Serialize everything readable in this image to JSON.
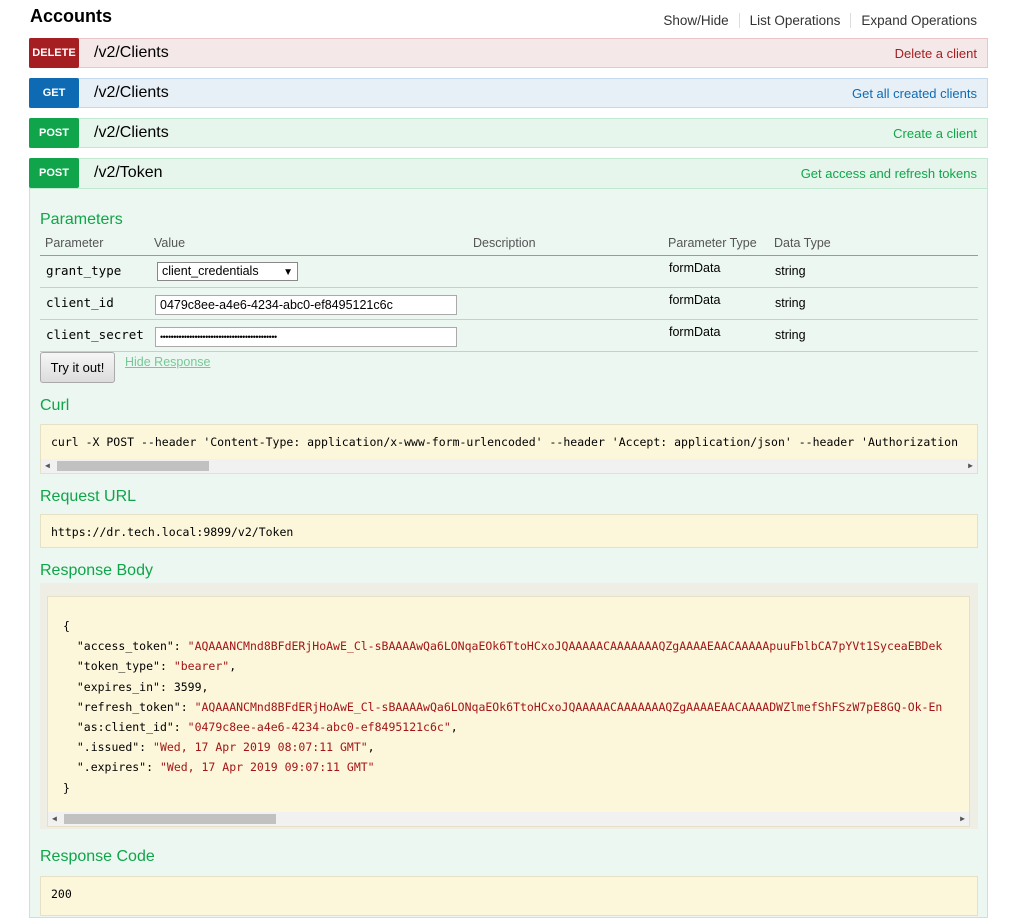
{
  "header": {
    "title": "Accounts",
    "links": [
      "Show/Hide",
      "List Operations",
      "Expand Operations"
    ]
  },
  "operations": [
    {
      "method": "DELETE",
      "path": "/v2/Clients",
      "summary": "Delete a client"
    },
    {
      "method": "GET",
      "path": "/v2/Clients",
      "summary": "Get all created clients"
    },
    {
      "method": "POST",
      "path": "/v2/Clients",
      "summary": "Create a client"
    },
    {
      "method": "POST",
      "path": "/v2/Token",
      "summary": "Get access and refresh tokens"
    }
  ],
  "parameters": {
    "title": "Parameters",
    "columns": [
      "Parameter",
      "Value",
      "Description",
      "Parameter Type",
      "Data Type"
    ],
    "rows": [
      {
        "name": "grant_type",
        "value": "client_credentials",
        "type": "formData",
        "data_type": "string"
      },
      {
        "name": "client_id",
        "value": "0479c8ee-a4e6-4234-abc0-ef8495121c6c",
        "type": "formData",
        "data_type": "string"
      },
      {
        "name": "client_secret",
        "value": "••••••••••••••••••••••••••••••••••••••••••••",
        "type": "formData",
        "data_type": "string"
      }
    ]
  },
  "actions": {
    "try_label": "Try it out!",
    "hide_label": "Hide Response"
  },
  "curl": {
    "title": "Curl",
    "command": "curl -X POST --header 'Content-Type: application/x-www-form-urlencoded' --header 'Accept: application/json' --header 'Authorization"
  },
  "request_url": {
    "title": "Request URL",
    "value": "https://dr.tech.local:9899/v2/Token"
  },
  "response_body": {
    "title": "Response Body",
    "open": "{",
    "close": "}",
    "lines": [
      {
        "key": "\"access_token\"",
        "value": "\"AQAAANCMnd8BFdERjHoAwE_Cl-sBAAAAwQa6LONqaEOk6TtoHCxoJQAAAAACAAAAAAAQZgAAAAEAACAAAAApuuFblbCA7pYVt1SyceaEBDek",
        "suffix": ""
      },
      {
        "key": "\"token_type\"",
        "value": "\"bearer\"",
        "suffix": ","
      },
      {
        "key": "\"expires_in\"",
        "value": "3599",
        "suffix": ","
      },
      {
        "key": "\"refresh_token\"",
        "value": "\"AQAAANCMnd8BFdERjHoAwE_Cl-sBAAAAwQa6LONqaEOk6TtoHCxoJQAAAAACAAAAAAAQZgAAAAEAACAAAADWZlmefShFSzW7pE8GQ-Ok-En",
        "suffix": ""
      },
      {
        "key": "\"as:client_id\"",
        "value": "\"0479c8ee-a4e6-4234-abc0-ef8495121c6c\"",
        "suffix": ","
      },
      {
        "key": "\".issued\"",
        "value": "\"Wed, 17 Apr 2019 08:07:11 GMT\"",
        "suffix": ","
      },
      {
        "key": "\".expires\"",
        "value": "\"Wed, 17 Apr 2019 09:07:11 GMT\"",
        "suffix": ""
      }
    ]
  },
  "response_code": {
    "title": "Response Code",
    "value": "200"
  }
}
